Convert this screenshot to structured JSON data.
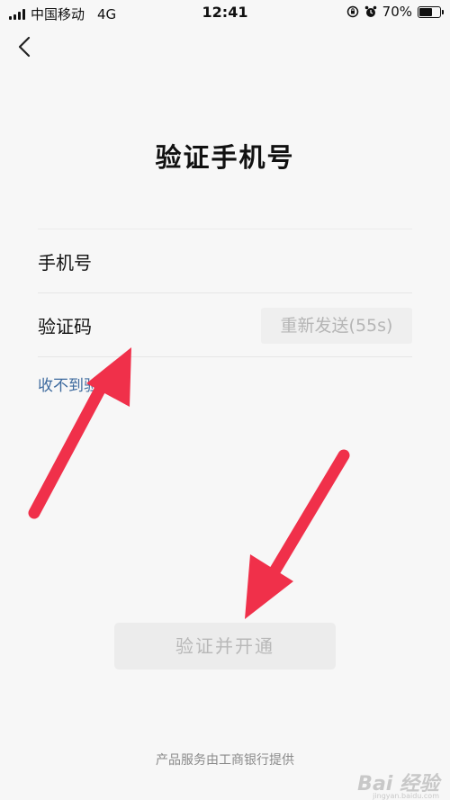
{
  "status_bar": {
    "carrier": "中国移动",
    "network": "4G",
    "time": "12:41",
    "battery_percent": "70%",
    "battery_level": 0.7
  },
  "page": {
    "title": "验证手机号"
  },
  "form": {
    "phone_label": "手机号",
    "code_label": "验证码",
    "resend_label": "重新发送(55s)",
    "no_code_link": "收不到验证码"
  },
  "submit_label": "验证并开通",
  "footer_text": "产品服务由工商银行提供",
  "watermark": {
    "text": "Bai 经验",
    "sub": "jingyan.baidu.com"
  },
  "colors": {
    "arrow": "#f0304a",
    "link": "#3d6a9e"
  },
  "icons": {
    "back": "chevron-left-icon",
    "signal": "signal-bars-icon",
    "lock": "orientation-lock-icon",
    "alarm": "alarm-icon",
    "battery": "battery-icon"
  }
}
